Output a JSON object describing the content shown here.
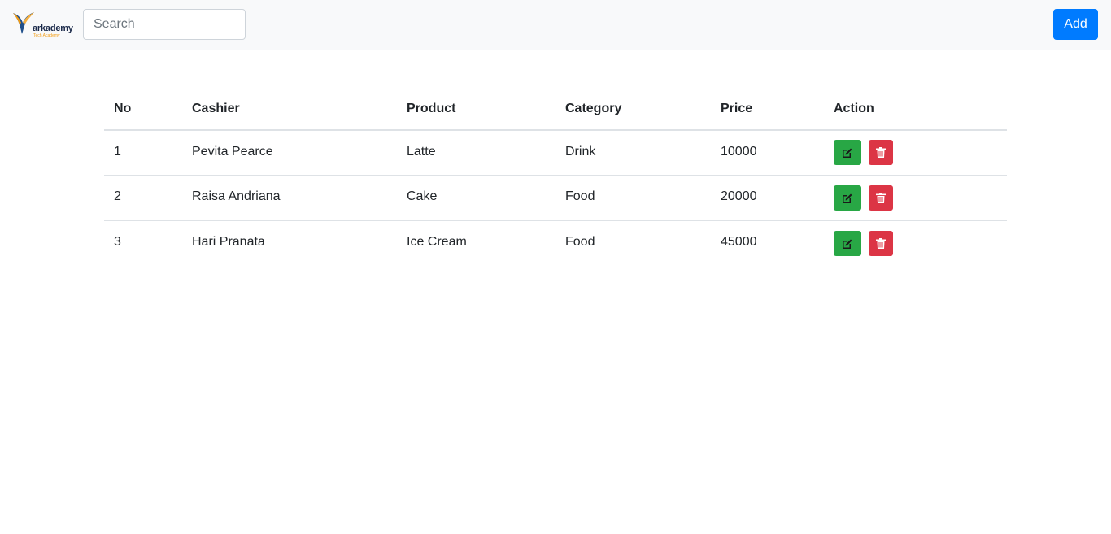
{
  "brand": {
    "name": "arkademy",
    "tagline": "Tech Academy"
  },
  "search": {
    "placeholder": "Search",
    "value": ""
  },
  "add_button": {
    "label": "Add"
  },
  "table": {
    "headers": [
      "No",
      "Cashier",
      "Product",
      "Category",
      "Price",
      "Action"
    ],
    "rows": [
      {
        "no": "1",
        "cashier": "Pevita Pearce",
        "product": "Latte",
        "category": "Drink",
        "price": "10000"
      },
      {
        "no": "2",
        "cashier": "Raisa Andriana",
        "product": "Cake",
        "category": "Food",
        "price": "20000"
      },
      {
        "no": "3",
        "cashier": "Hari Pranata",
        "product": "Ice Cream",
        "category": "Food",
        "price": "45000"
      }
    ],
    "actions": {
      "edit_icon": "edit-icon",
      "delete_icon": "trash-icon"
    }
  },
  "colors": {
    "primary": "#007bff",
    "edit": "#28a745",
    "delete": "#dc3545",
    "navbar": "#f8f9fa"
  }
}
